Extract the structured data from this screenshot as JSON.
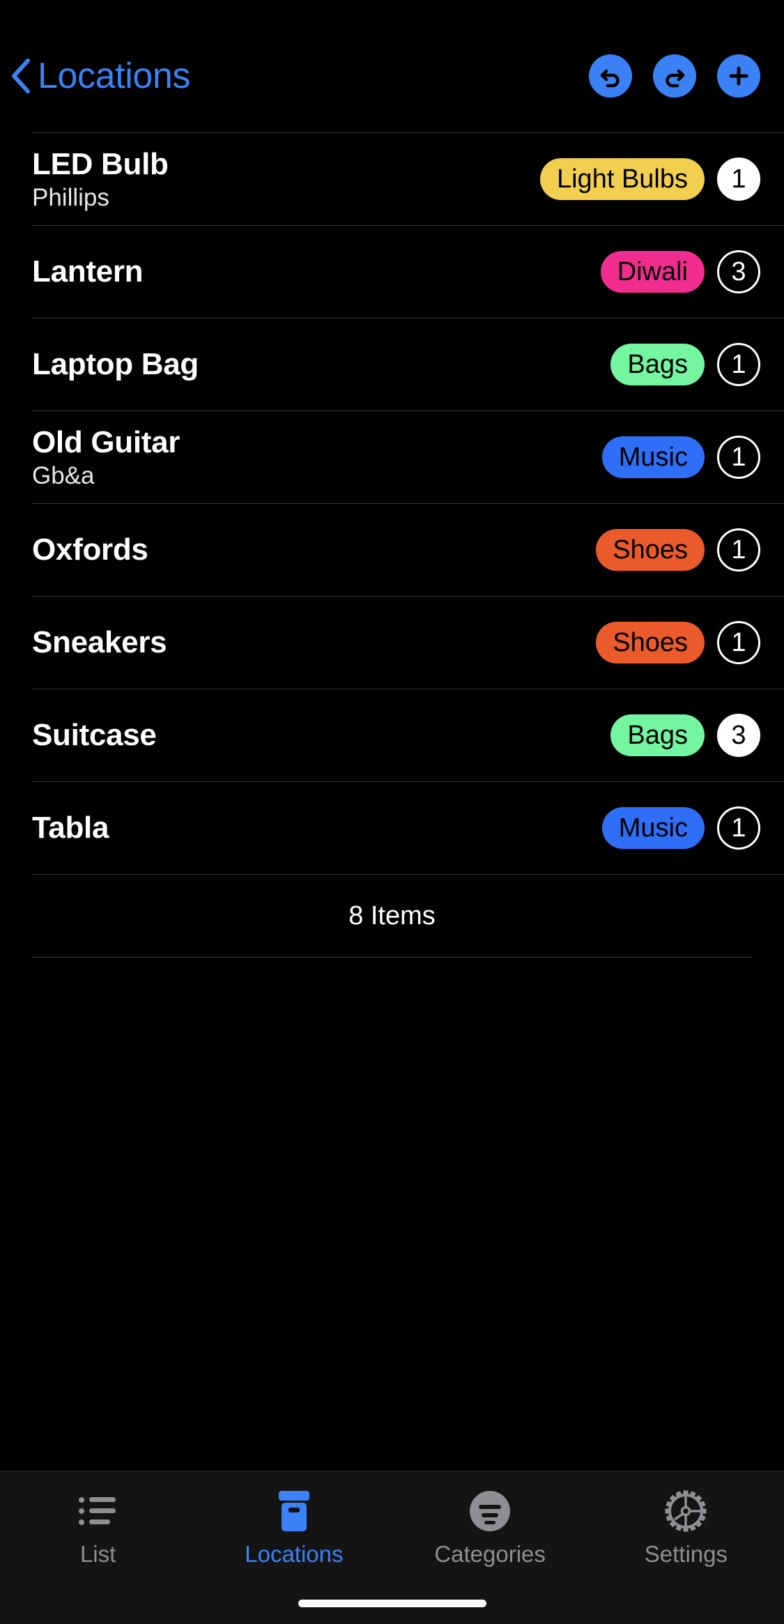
{
  "navbar": {
    "back_label": "Locations",
    "back_icon": "chevron-left-icon",
    "actions": [
      {
        "name": "undo-button",
        "icon": "undo-arrow-icon"
      },
      {
        "name": "redo-button",
        "icon": "redo-arrow-icon"
      },
      {
        "name": "add-button",
        "icon": "plus-icon"
      }
    ]
  },
  "colors": {
    "accent": "#3b82f6",
    "background": "#000000",
    "separator": "#3a3a3c",
    "tabbar_background": "#141414",
    "tab_inactive": "#8e8e93",
    "badge_light_bulbs": "#f2cf4f",
    "badge_diwali": "#f02d8f",
    "badge_bags": "#74f6a0",
    "badge_music": "#2f6ef7",
    "badge_shoes": "#ea5a2b"
  },
  "list": {
    "rows": [
      {
        "title": "LED Bulb",
        "subtitle": "Phillips",
        "category": "Light Bulbs",
        "category_color": "#f2cf4f",
        "count": "1",
        "count_style": "filled"
      },
      {
        "title": "Lantern",
        "subtitle": "",
        "category": "Diwali",
        "category_color": "#f02d8f",
        "count": "3",
        "count_style": "outline"
      },
      {
        "title": "Laptop Bag",
        "subtitle": "",
        "category": "Bags",
        "category_color": "#74f6a0",
        "count": "1",
        "count_style": "outline"
      },
      {
        "title": "Old Guitar",
        "subtitle": "Gb&a",
        "category": "Music",
        "category_color": "#2f6ef7",
        "count": "1",
        "count_style": "outline"
      },
      {
        "title": "Oxfords",
        "subtitle": "",
        "category": "Shoes",
        "category_color": "#ea5a2b",
        "count": "1",
        "count_style": "outline"
      },
      {
        "title": "Sneakers",
        "subtitle": "",
        "category": "Shoes",
        "category_color": "#ea5a2b",
        "count": "1",
        "count_style": "outline"
      },
      {
        "title": "Suitcase",
        "subtitle": "",
        "category": "Bags",
        "category_color": "#74f6a0",
        "count": "3",
        "count_style": "filled"
      },
      {
        "title": "Tabla",
        "subtitle": "",
        "category": "Music",
        "category_color": "#2f6ef7",
        "count": "1",
        "count_style": "outline"
      }
    ],
    "footer_count": "8 Items"
  },
  "tabbar": {
    "tabs": [
      {
        "label": "List",
        "icon": "bulleted-list-icon",
        "active": false
      },
      {
        "label": "Locations",
        "icon": "archive-box-icon",
        "active": true
      },
      {
        "label": "Categories",
        "icon": "filter-circle-icon",
        "active": false
      },
      {
        "label": "Settings",
        "icon": "gear-icon",
        "active": false
      }
    ]
  }
}
